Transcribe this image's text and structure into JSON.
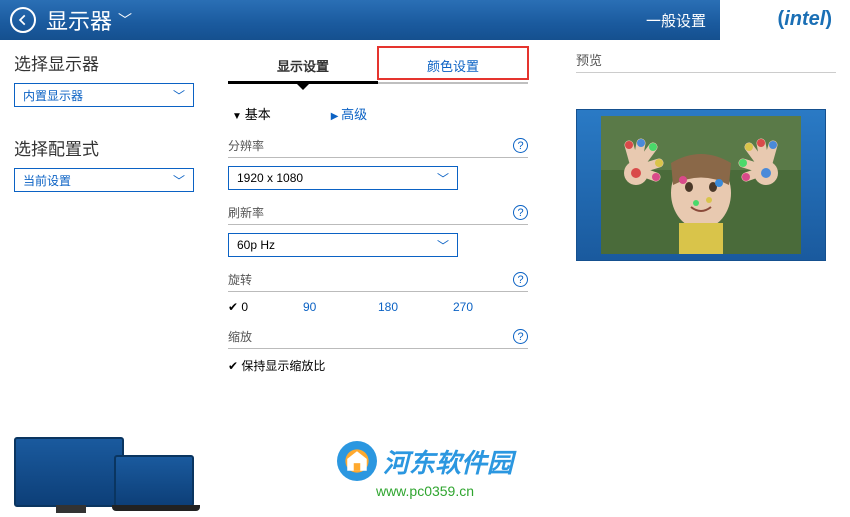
{
  "header": {
    "title": "显示器",
    "settings_label": "一般设置",
    "brand": "intel"
  },
  "sidebar": {
    "select_display_label": "选择显示器",
    "select_display_value": "内置显示器",
    "select_config_label": "选择配置式",
    "select_config_value": "当前设置"
  },
  "tabs": {
    "display": "显示设置",
    "color": "颜色设置"
  },
  "modes": {
    "basic": "基本",
    "advanced": "高级"
  },
  "sections": {
    "resolution": {
      "label": "分辨率",
      "value": "1920 x 1080"
    },
    "refresh": {
      "label": "刷新率",
      "value": "60p Hz"
    },
    "rotation": {
      "label": "旋转",
      "options": [
        "0",
        "90",
        "180",
        "270"
      ],
      "selected": "0"
    },
    "scaling": {
      "label": "缩放",
      "checkbox": "保持显示缩放比"
    }
  },
  "preview": {
    "label": "预览"
  },
  "watermark": {
    "name": "河东软件园",
    "url": "www.pc0359.cn"
  }
}
